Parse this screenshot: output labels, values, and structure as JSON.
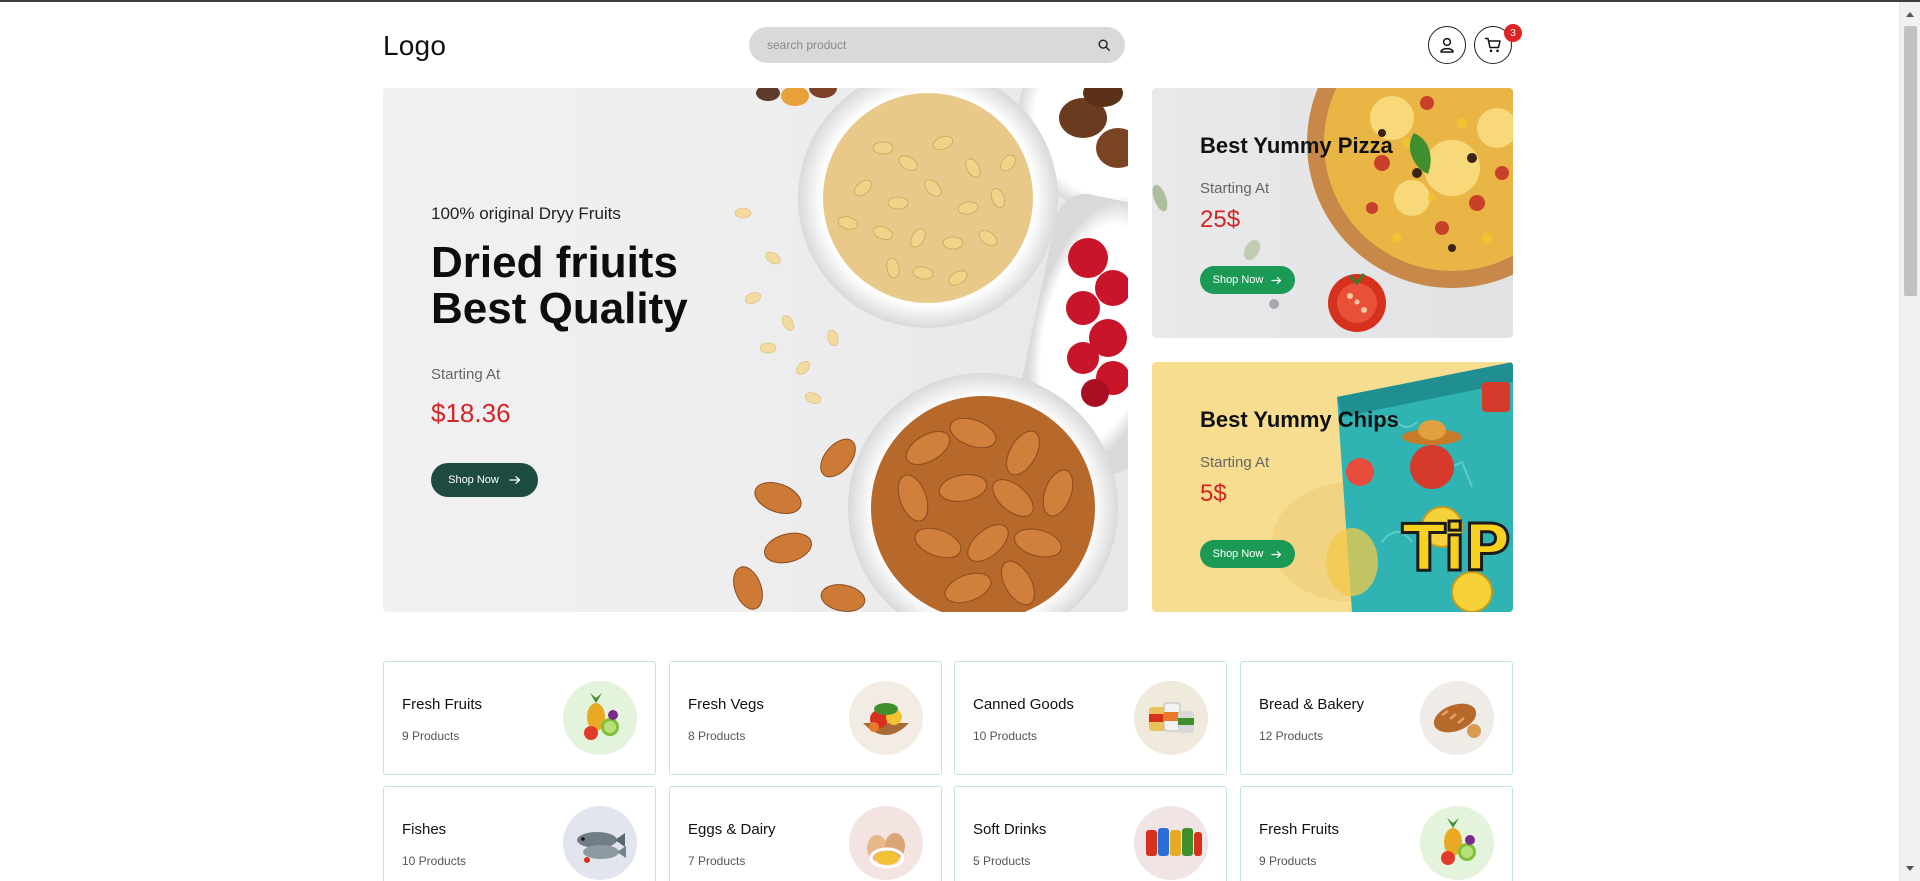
{
  "header": {
    "logo": "Logo",
    "search_placeholder": "search product",
    "cart_count": "3"
  },
  "hero": {
    "subtitle": "100% original Dryy Fruits",
    "title_line1": "Dried friuits",
    "title_line2": "Best Quality",
    "starting_label": "Starting At",
    "price": "$18.36",
    "button_label": "Shop Now"
  },
  "banners": [
    {
      "title": "Best Yummy Pizza",
      "starting_label": "Starting At",
      "price": "25$",
      "button_label": "Shop Now"
    },
    {
      "title": "Best Yummy Chips",
      "starting_label": "Starting At",
      "price": "5$",
      "button_label": "Shop Now"
    }
  ],
  "chips_brand": "TiP",
  "categories": [
    {
      "name": "Fresh Fruits",
      "count": "9 Products",
      "icon": "fruits-icon"
    },
    {
      "name": "Fresh Vegs",
      "count": "8 Products",
      "icon": "vegetables-icon"
    },
    {
      "name": "Canned Goods",
      "count": "10 Products",
      "icon": "canned-goods-icon"
    },
    {
      "name": "Bread & Bakery",
      "count": "12 Products",
      "icon": "bread-icon"
    },
    {
      "name": "Fishes",
      "count": "10 Products",
      "icon": "fish-icon"
    },
    {
      "name": "Eggs & Dairy",
      "count": "7 Products",
      "icon": "eggs-icon"
    },
    {
      "name": "Soft Drinks",
      "count": "5 Products",
      "icon": "drinks-icon"
    },
    {
      "name": "Fresh Fruits",
      "count": "9 Products",
      "icon": "fruits-icon"
    }
  ],
  "colors": {
    "accent_red": "#d42424",
    "hero_button": "#1d4b3f",
    "banner_button": "#1b9a55",
    "category_border": "#bfe9cf",
    "search_bg": "#d9d9d9"
  }
}
